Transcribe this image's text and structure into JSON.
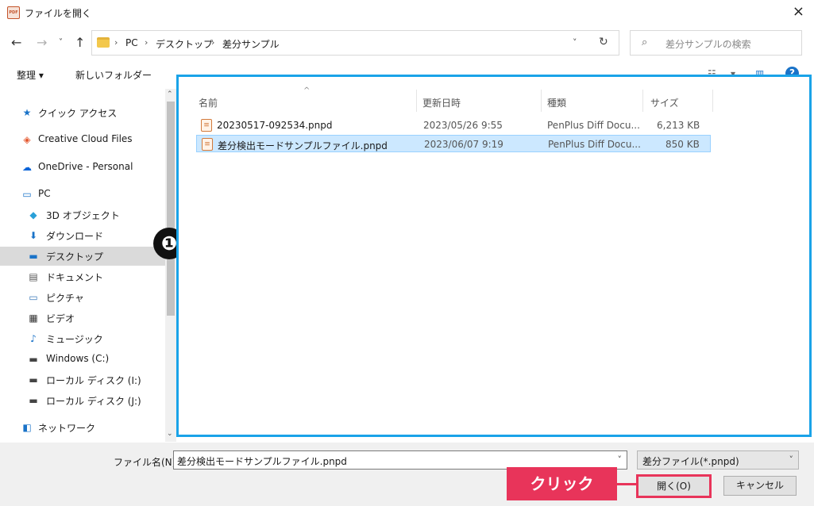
{
  "window": {
    "title": "ファイルを開く",
    "app_icon_text": "PDF",
    "close_glyph": "×"
  },
  "nav": {
    "back": "←",
    "forward": "→",
    "dropdown": "˅",
    "up": "↑"
  },
  "address": {
    "crumbs": [
      "PC",
      "デスクトップ",
      "差分サンプル"
    ],
    "separator": "›",
    "dropdown": "˅",
    "refresh": "↻"
  },
  "search": {
    "icon": "⌕",
    "placeholder": "差分サンプルの検索"
  },
  "toolbar": {
    "organize": "整理 ▾",
    "new_folder": "新しいフォルダー",
    "view_icon": "☷",
    "view_dd": "▾",
    "pane_icon": "▥",
    "help": "?"
  },
  "sidebar": {
    "items": [
      {
        "label": "クイック アクセス",
        "icon": "★",
        "color": "#1a73c8"
      },
      {
        "label": "Creative Cloud Files",
        "icon": "◈",
        "color": "#e4572e"
      },
      {
        "label": "OneDrive - Personal",
        "icon": "☁",
        "color": "#0a64d8"
      },
      {
        "label": "PC",
        "icon": "▭",
        "color": "#1a73c8"
      },
      {
        "label": "3D オブジェクト",
        "icon": "◆",
        "color": "#2aa0d8"
      },
      {
        "label": "ダウンロード",
        "icon": "⬇",
        "color": "#1a73c8"
      },
      {
        "label": "デスクトップ",
        "icon": "▬",
        "color": "#1a73c8"
      },
      {
        "label": "ドキュメント",
        "icon": "▤",
        "color": "#555555"
      },
      {
        "label": "ピクチャ",
        "icon": "▭",
        "color": "#3a78b8"
      },
      {
        "label": "ビデオ",
        "icon": "▦",
        "color": "#333333"
      },
      {
        "label": "ミュージック",
        "icon": "♪",
        "color": "#1a73c8"
      },
      {
        "label": "Windows (C:)",
        "icon": "▬",
        "color": "#444444"
      },
      {
        "label": "ローカル ディスク (I:)",
        "icon": "▬",
        "color": "#444444"
      },
      {
        "label": "ローカル ディスク (J:)",
        "icon": "▬",
        "color": "#444444"
      },
      {
        "label": "ネットワーク",
        "icon": "◧",
        "color": "#1a73c8"
      }
    ],
    "scroll_up": "⌃",
    "scroll_down": "⌄"
  },
  "files": {
    "columns": [
      "名前",
      "更新日時",
      "種類",
      "サイズ"
    ],
    "sort_arrow": "^",
    "rows": [
      {
        "name": "20230517-092534.pnpd",
        "date": "2023/05/26 9:55",
        "type": "PenPlus Diff Docu...",
        "size": "6,213 KB"
      },
      {
        "name": "差分検出モードサンプルファイル.pnpd",
        "date": "2023/06/07 9:19",
        "type": "PenPlus Diff Docu...",
        "size": "850 KB"
      }
    ],
    "file_icon": "≡"
  },
  "annotation": {
    "badge": "❶",
    "click_label": "クリック",
    "accent": "#e8345a",
    "highlight": "#1aa3e8"
  },
  "bottom": {
    "filename_label": "ファイル名(N):",
    "filename_value": "差分検出モードサンプルファイル.pnpd",
    "filter_value": "差分ファイル(*.pnpd)",
    "dropdown": "˅",
    "open": "開く(O)",
    "cancel": "キャンセル"
  }
}
